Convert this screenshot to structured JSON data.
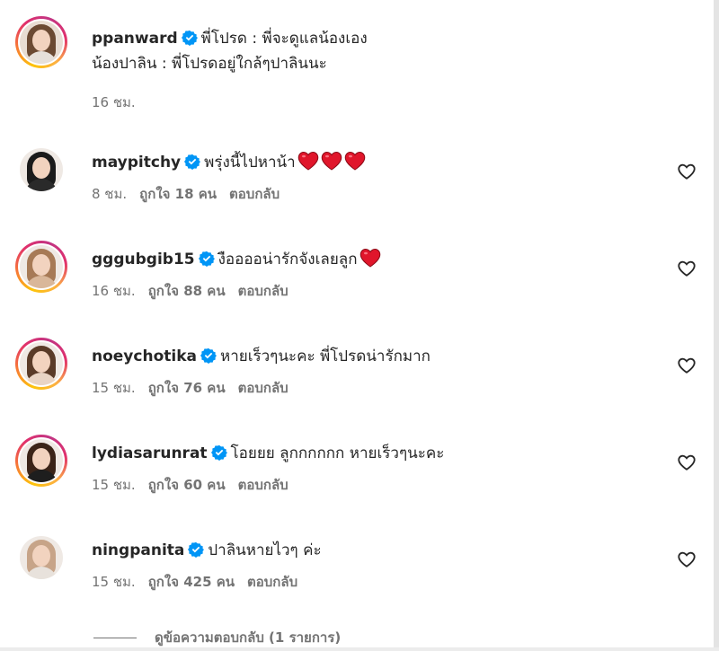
{
  "post": {
    "username": "ppanward",
    "caption_line1": "พี่โปรด : พี่จะดูแลน้องเอง",
    "caption_line2": "น้องปาลิน : พี่โปรดอยู่ใกล้ๆปาลินนะ",
    "time": "16 ชม."
  },
  "comments": [
    {
      "username": "maypitchy",
      "text": "พรุ่งนี้ไปหาน้า",
      "hearts": 3,
      "time": "8 ชม.",
      "likes": "ถูกใจ 18 คน",
      "reply": "ตอบกลับ",
      "ring": false,
      "hair": "#1b1b1b",
      "outfit": "#2a2a2a"
    },
    {
      "username": "gggubgib15",
      "text": "งืออออน่ารักจังเลยลูก",
      "hearts": 1,
      "time": "16 ชม.",
      "likes": "ถูกใจ 88 คน",
      "reply": "ตอบกลับ",
      "ring": true,
      "hair": "#a77a56",
      "outfit": "#d9b79a"
    },
    {
      "username": "noeychotika",
      "text": "หายเร็วๆนะคะ พี่โปรดน่ารักมาก",
      "hearts": 0,
      "time": "15 ชม.",
      "likes": "ถูกใจ 76 คน",
      "reply": "ตอบกลับ",
      "ring": true,
      "hair": "#5a3b28",
      "outfit": "#e9d4c4"
    },
    {
      "username": "lydiasarunrat",
      "text": "โอยยย ลูกกกกกก หายเร็วๆนะคะ",
      "hearts": 0,
      "time": "15 ชม.",
      "likes": "ถูกใจ 60 คน",
      "reply": "ตอบกลับ",
      "ring": true,
      "hair": "#3b2418",
      "outfit": "#1e1e1e"
    },
    {
      "username": "ningpanita",
      "text": "ปาลินหายไวๆ ค่ะ",
      "hearts": 0,
      "time": "15 ชม.",
      "likes": "ถูกใจ 425 คน",
      "reply": "ตอบกลับ",
      "ring": false,
      "hair": "#c7a488",
      "outfit": "#e8e2dc"
    }
  ],
  "view_replies": "ดูข้อความตอบกลับ (1 รายการ)",
  "colors": {
    "verified": "#0095f6",
    "ring_start": "#fdc40b",
    "ring_end": "#c13584",
    "heart_emoji": "#e0162b",
    "muted": "#737373"
  }
}
